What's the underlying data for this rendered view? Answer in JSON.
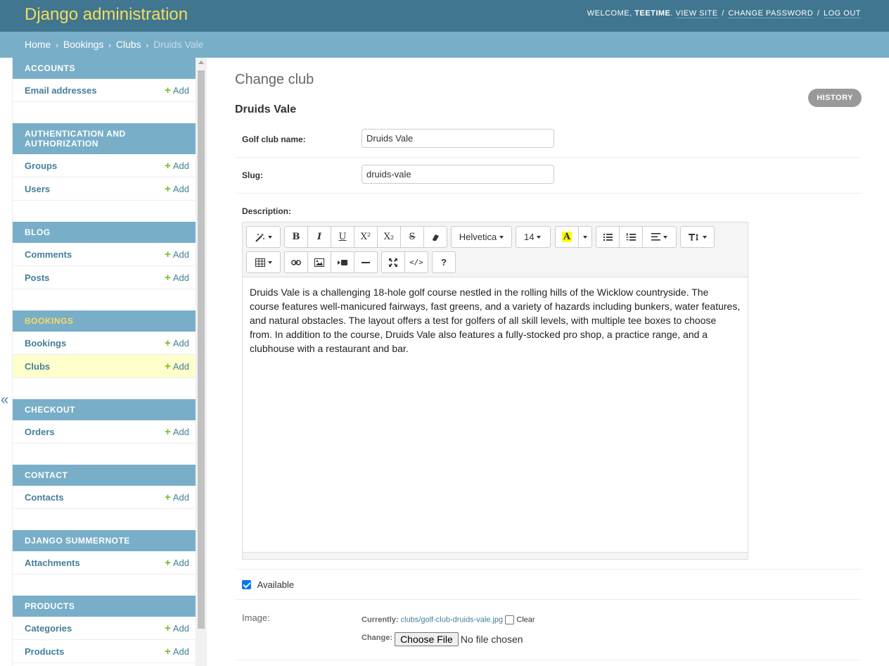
{
  "header": {
    "branding": "Django administration",
    "welcome": "WELCOME,",
    "username": "TEETIME",
    "view_site": "VIEW SITE",
    "change_password": "CHANGE PASSWORD",
    "log_out": "LOG OUT",
    "separator": "/"
  },
  "breadcrumbs": {
    "home": "Home",
    "app": "Bookings",
    "model": "Clubs",
    "current": "Druids Vale",
    "arrow": "›"
  },
  "sidebar": {
    "toggle": "«",
    "add_label": "Add",
    "plus": "+",
    "modules": [
      {
        "caption": "ACCOUNTS",
        "models": [
          "Email addresses"
        ]
      },
      {
        "caption": "AUTHENTICATION AND AUTHORIZATION",
        "models": [
          "Groups",
          "Users"
        ]
      },
      {
        "caption": "BLOG",
        "models": [
          "Comments",
          "Posts"
        ]
      },
      {
        "caption": "BOOKINGS",
        "models": [
          "Bookings",
          "Clubs"
        ]
      },
      {
        "caption": "CHECKOUT",
        "models": [
          "Orders"
        ]
      },
      {
        "caption": "CONTACT",
        "models": [
          "Contacts"
        ]
      },
      {
        "caption": "DJANGO SUMMERNOTE",
        "models": [
          "Attachments"
        ]
      },
      {
        "caption": "PRODUCTS",
        "models": [
          "Categories",
          "Products"
        ]
      }
    ]
  },
  "content": {
    "page_title": "Change club",
    "history": "HISTORY",
    "object_title": "Druids Vale",
    "fields": {
      "name_label": "Golf club name:",
      "name_value": "Druids Vale",
      "slug_label": "Slug:",
      "slug_value": "druids-vale",
      "description_label": "Description:",
      "description_text": "Druids Vale is a challenging 18-hole golf course nestled in the rolling hills of the Wicklow countryside. The course features well-manicured fairways, fast greens, and a variety of hazards including bunkers, water features, and natural obstacles. The layout offers a test for golfers of all skill levels, with multiple tee boxes to choose from. In addition to the course, Druids Vale also features a fully-stocked pro shop, a practice range, and a clubhouse with a restaurant and bar.",
      "available_label": "Available",
      "available_checked": true,
      "image_label": "Image:",
      "currently_label": "Currently:",
      "currently_link": "clubs/golf-club-druids-vale.jpg",
      "clear_label": "Clear",
      "change_label": "Change:",
      "choose_file": "Choose File",
      "no_file": "No file chosen"
    },
    "toolbar": {
      "bold": "B",
      "italic": "I",
      "underline": "U",
      "superscript": "X²",
      "subscript": "X₂",
      "strikethrough": "S",
      "font_name": "Helvetica",
      "font_size": "14",
      "color_glyph": "A",
      "help": "?",
      "code": "</>"
    }
  },
  "colors": {
    "header_bg": "#417690",
    "breadcrumb_bg": "#79aec8",
    "brand_yellow": "#f5dd5d",
    "link_blue": "#447e9b",
    "add_green": "#70bf2b",
    "current_row": "#ffffcc"
  }
}
